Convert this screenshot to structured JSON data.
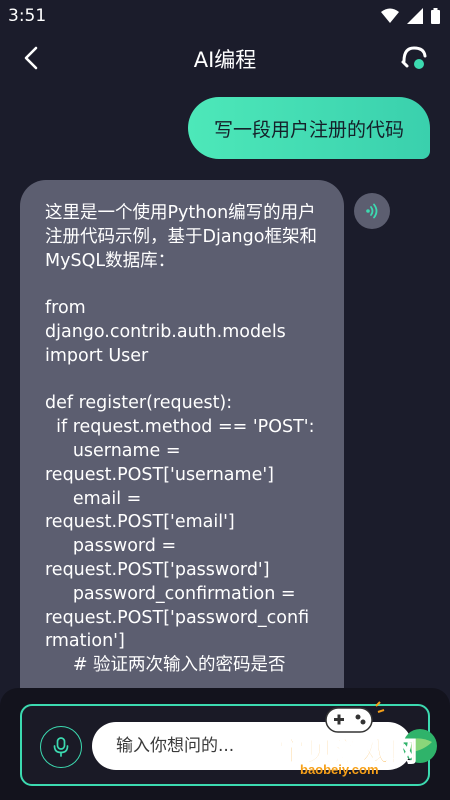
{
  "status_bar": {
    "time": "3:51"
  },
  "header": {
    "title": "AI编程"
  },
  "conversation": {
    "user_message": "写一段用户注册的代码",
    "ai_message": "这里是一个使用Python编写的用户注册代码示例，基于Django框架和MySQL数据库：\n\nfrom\ndjango.contrib.auth.models\nimport User\n\ndef register(request):\n  if request.method == 'POST':\n     username =\nrequest.POST['username']\n     email =\nrequest.POST['email']\n     password =\nrequest.POST['password']\n     password_confirmation =\nrequest.POST['password_confi\nrmation']\n     # 验证两次输入的密码是否"
  },
  "composer": {
    "placeholder": "输入你想问的..."
  },
  "watermark": {
    "brand": "宝贝游戏网",
    "url": "baobeiy.com"
  },
  "colors": {
    "accent": "#3cdab0",
    "background": "#1b1c2b",
    "ai_bubble": "#5c5e70"
  },
  "icons": {
    "back": "back-arrow-icon",
    "headset": "headset-icon",
    "speaker": "sound-wave-icon",
    "mic": "microphone-icon"
  }
}
